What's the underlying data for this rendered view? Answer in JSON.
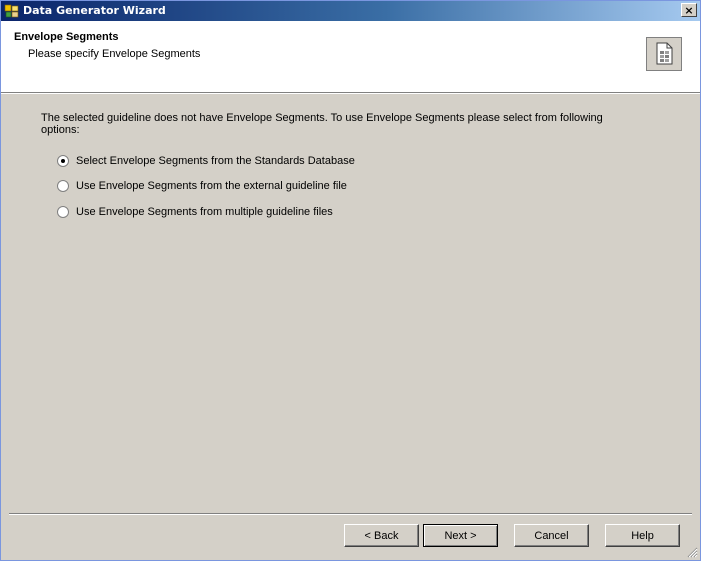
{
  "window": {
    "title": "Data Generator Wizard",
    "close_glyph": "×"
  },
  "header": {
    "title": "Envelope Segments",
    "subtitle": "Please specify Envelope Segments",
    "icon": "document-grid-icon"
  },
  "content": {
    "intro": "The selected guideline does not have Envelope Segments. To use Envelope Segments please select from following options:",
    "options": [
      {
        "label": "Select Envelope Segments from the Standards Database",
        "checked": true
      },
      {
        "label": "Use Envelope Segments from the external guideline file",
        "checked": false
      },
      {
        "label": "Use Envelope Segments from multiple guideline files",
        "checked": false
      }
    ]
  },
  "buttons": {
    "back": "< Back",
    "next": "Next >",
    "cancel": "Cancel",
    "help": "Help"
  }
}
